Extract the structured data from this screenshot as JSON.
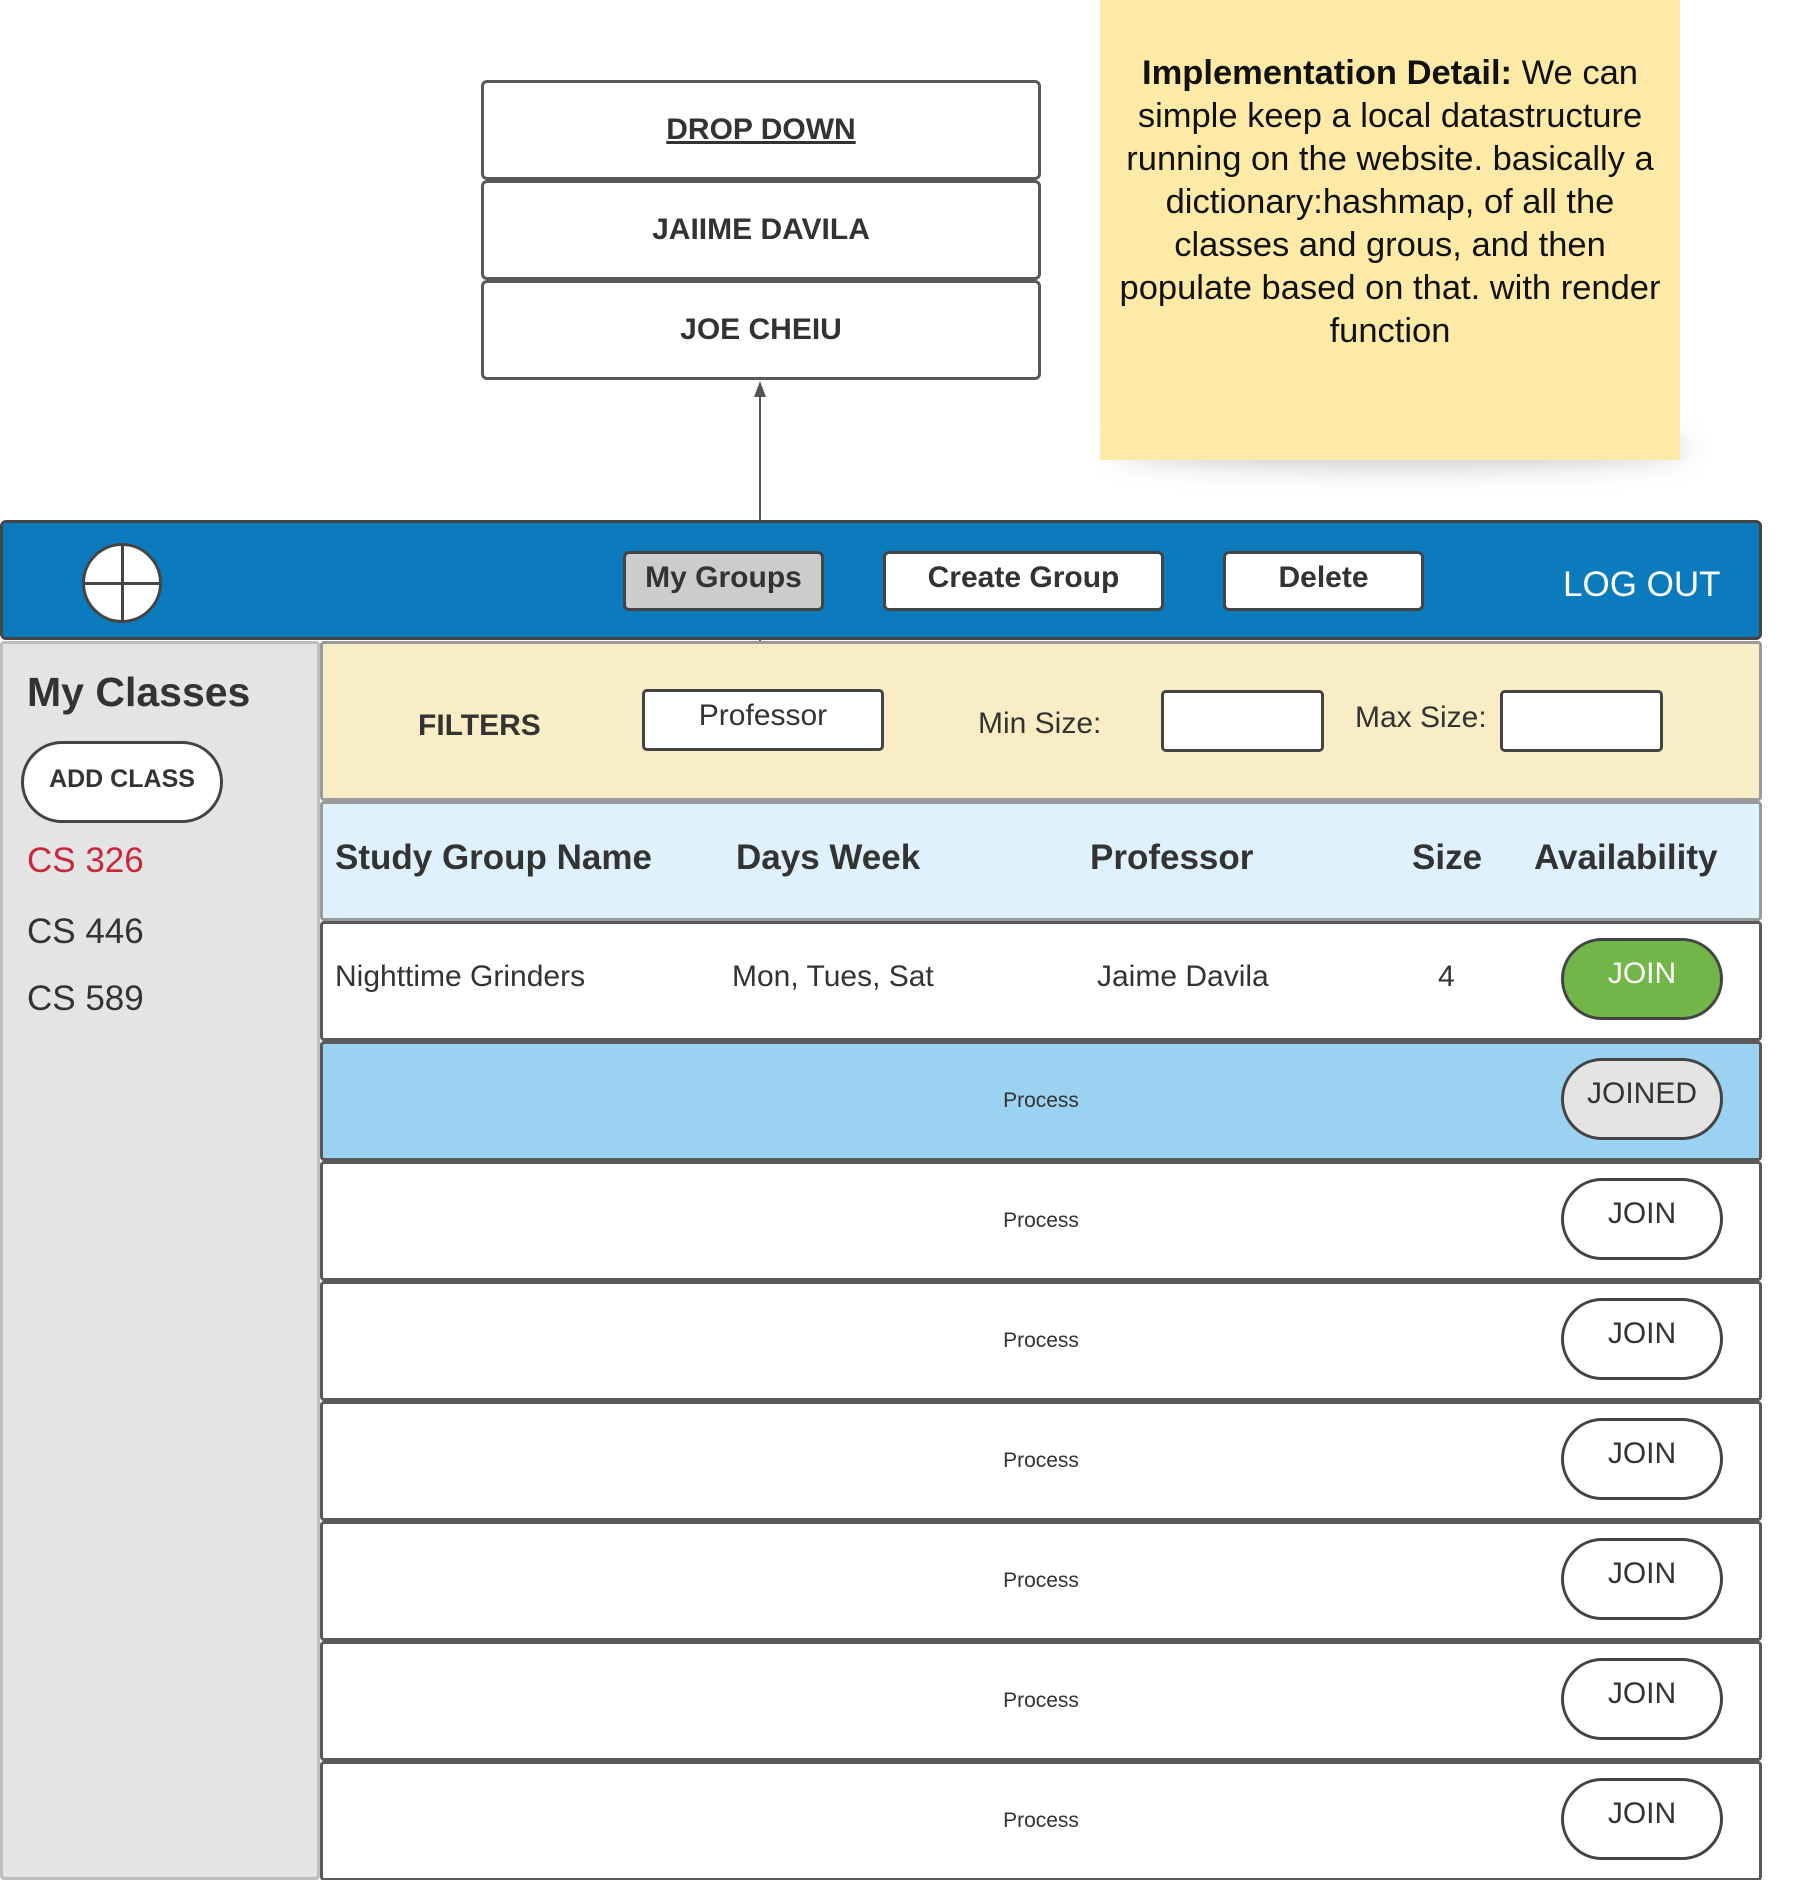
{
  "dropdown": {
    "title": "DROP DOWN",
    "options": [
      "JAIIME DAVILA",
      "JOE CHEIU"
    ]
  },
  "note": {
    "label": "Implementation Detail:",
    "text": " We can simple keep a local datastructure running on the website. basically a dictionary:hashmap, of all the classes and grous, and then populate based on that.  with render function",
    "color": "#fdeaa7"
  },
  "header": {
    "logo_icon": "crosshair-circle-icon",
    "nav": [
      "My Groups",
      "Create Group",
      "Delete"
    ],
    "active_nav": "My Groups",
    "logout": "LOG OUT",
    "color": "#0c7bbd"
  },
  "sidebar": {
    "title": "My Classes",
    "add_button": "ADD CLASS",
    "classes": [
      "CS 326",
      "CS 446",
      "CS 589"
    ],
    "active_class": "CS 326",
    "active_color": "#c8283b"
  },
  "filters": {
    "label": "FILTERS",
    "professor": "Professor",
    "min_label": "Min Size:",
    "max_label": "Max Size:",
    "min_value": "",
    "max_value": ""
  },
  "table": {
    "columns": [
      "Study Group Name",
      "Days Week",
      "Professor",
      "Size",
      "Availability"
    ],
    "rows": [
      {
        "name": "Nighttime Grinders",
        "days": "Mon, Tues, Sat",
        "professor": "Jaime Davila",
        "size": "4",
        "action": "JOIN",
        "state": "available-highlight"
      },
      {
        "placeholder": "Process",
        "action": "JOINED",
        "state": "joined"
      },
      {
        "placeholder": "Process",
        "action": "JOIN",
        "state": "available"
      },
      {
        "placeholder": "Process",
        "action": "JOIN",
        "state": "available"
      },
      {
        "placeholder": "Process",
        "action": "JOIN",
        "state": "available"
      },
      {
        "placeholder": "Process",
        "action": "JOIN",
        "state": "available"
      },
      {
        "placeholder": "Process",
        "action": "JOIN",
        "state": "available"
      },
      {
        "placeholder": "Process",
        "action": "JOIN",
        "state": "available"
      }
    ],
    "join_color": "#72b548",
    "selected_row_color": "#9bd1f1"
  }
}
